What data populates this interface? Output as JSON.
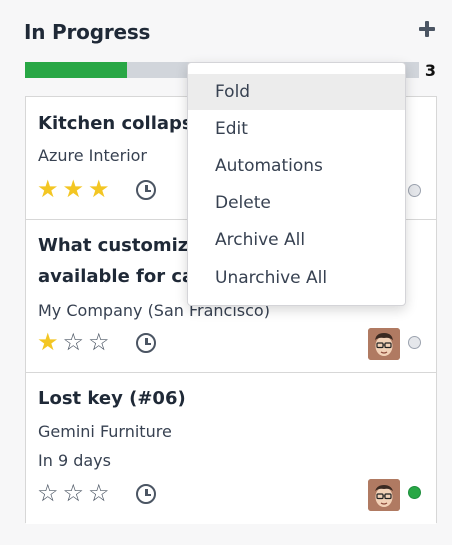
{
  "column": {
    "title": "In Progress",
    "add_icon": "plus-icon",
    "count": "3",
    "progress_fraction": 0.26,
    "progress_color": "#28a745"
  },
  "cards": [
    {
      "title": "Kitchen collaps",
      "subtitle": "Azure Interior",
      "rating": 3,
      "max_rating": 5,
      "status": "grey",
      "avatar": false
    },
    {
      "title_lines": [
        "What customiza",
        "available for ca"
      ],
      "subtitle": "My Company (San Francisco)",
      "rating": 1,
      "max_rating": 5,
      "status": "grey",
      "avatar": true
    },
    {
      "title": "Lost key (#06)",
      "subtitle": "Gemini Furniture",
      "deadline": "In 9 days",
      "rating": 0,
      "max_rating": 5,
      "status": "green",
      "avatar": true
    }
  ],
  "menu": {
    "items": [
      "Fold",
      "Edit",
      "Automations",
      "Delete",
      "Archive All",
      "Unarchive All"
    ],
    "highlighted": "Fold"
  },
  "colors": {
    "star_filled": "#f3c623",
    "status_done": "#28a745"
  }
}
